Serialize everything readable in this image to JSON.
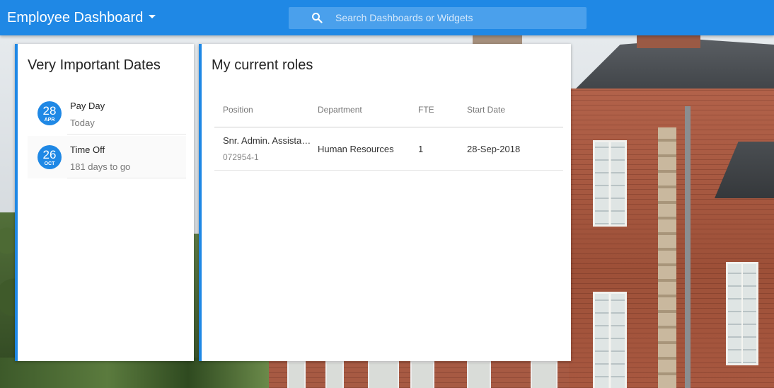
{
  "app": {
    "title": "Employee Dashboard"
  },
  "search": {
    "placeholder": "Search Dashboards or Widgets"
  },
  "dates_card": {
    "title": "Very Important Dates",
    "items": [
      {
        "day": "28",
        "month": "APR",
        "title": "Pay Day",
        "subtitle": "Today"
      },
      {
        "day": "26",
        "month": "OCT",
        "title": "Time Off",
        "subtitle": "181 days to go"
      }
    ]
  },
  "roles_card": {
    "title": "My current roles",
    "columns": [
      "Position",
      "Department",
      "FTE",
      "Start Date"
    ],
    "rows": [
      {
        "position": "Snr. Admin. Assista…",
        "position_id": "072954-1",
        "department": "Human Resources",
        "fte": "1",
        "start_date": "28-Sep-2018"
      }
    ]
  },
  "colors": {
    "accent": "#1f88e5"
  }
}
